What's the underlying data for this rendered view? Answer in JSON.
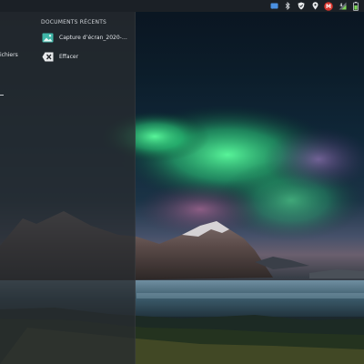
{
  "menu": {
    "section_title": "DOCUMENTS RÉCENTS",
    "partial_label": "ichiers",
    "recent_documents": [
      {
        "label": "Capture d’écran_2020-…",
        "icon": "image-file-icon"
      },
      {
        "label": "Effacer",
        "icon": "clear-icon"
      }
    ]
  },
  "tray": {
    "icons": [
      "notification-icon",
      "bluetooth-icon",
      "security-shield-icon",
      "location-pin-icon",
      "mail-icon",
      "network-icon",
      "battery-icon"
    ]
  },
  "colors": {
    "panel": "#1b2026",
    "menu_overlay": "#282b30",
    "aurora_green": "#36e58a",
    "image_icon": "#3fb6a8",
    "mail_badge": "#d8342c"
  }
}
